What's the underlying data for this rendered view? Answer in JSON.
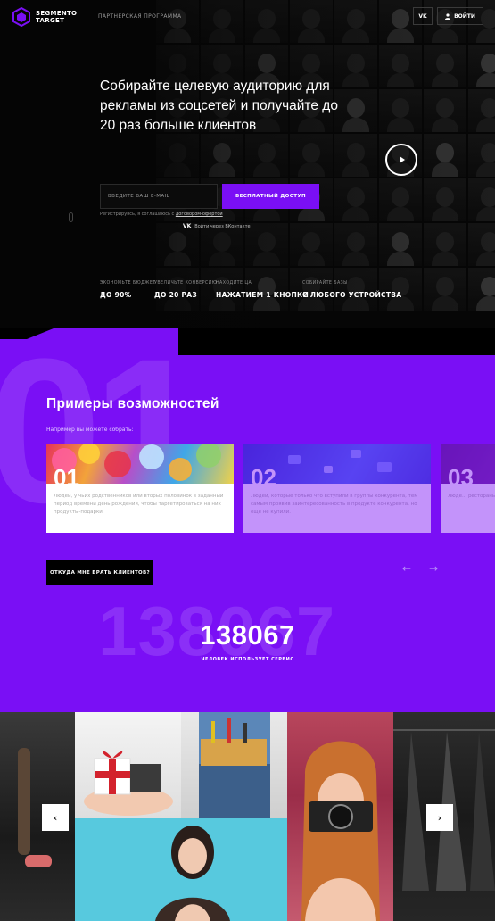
{
  "brand": {
    "logo_line1": "SEGMENTO",
    "logo_line2": "TARGET",
    "accent": "#7a0ff5",
    "logo_icon": "hexagon-cube-logo"
  },
  "header": {
    "partner_link": "ПАРТНЕРСКАЯ ПРОГРАММА",
    "vk_label": "VK",
    "login_label": "ВОЙТИ",
    "login_icon": "user-icon"
  },
  "hero": {
    "title": "Собирайте целевую аудиторию для рекламы из соцсетей и получайте до 20 раз больше клиентов",
    "email_placeholder": "ВВЕДИТЕ ВАШ E-MAIL",
    "cta_label": "БЕСПЛАТНЫЙ ДОСТУП",
    "agree_prefix": "Регистрируясь, я соглашаюсь с",
    "agree_link": "договором-офертой",
    "vk_login_icon": "VK",
    "vk_login_text": "Войти через ВКонтакте",
    "play_icon": "play-icon"
  },
  "stats": [
    {
      "label": "ЭКОНОМЬТЕ БЮДЖЕТ",
      "value": "ДО 90%"
    },
    {
      "label": "УВЕЛИЧЬТЕ КОНВЕРСИЮ",
      "value": "ДО 20 РАЗ"
    },
    {
      "label": "НАХОДИТЕ ЦА",
      "value": "НАЖАТИЕМ 1 КНОПКИ"
    },
    {
      "label": "СОБИРАЙТЕ БАЗЫ",
      "value": "С ЛЮБОГО УСТРОЙСТВА"
    }
  ],
  "features": {
    "big_number": "01",
    "title": "Примеры возможностей",
    "subtitle": "Например вы можете собрать:",
    "cards": [
      {
        "num": "01",
        "text": "Людей, у чьих родственников или вторых половинок в заданный период времени день рождения, чтобы таргетироваться на них продукты-подарки."
      },
      {
        "num": "02",
        "text": "Людей, которые только что вступили в группы конкурента, тем самым проявив заинтересованность в продукте конкурента, но ещё не купили."
      },
      {
        "num": "03",
        "text": "Люде... рестораны, ба..."
      }
    ],
    "where_button": "ОТКУДА МНЕ БРАТЬ КЛИЕНТОВ?",
    "prev_arrow": "←",
    "next_arrow": "→"
  },
  "counter": {
    "value": "138067",
    "label": "ЧЕЛОВЕК ИСПОЛЬЗУЕТ СЕРВИС"
  },
  "gallery": {
    "prev": "‹",
    "next": "›"
  }
}
